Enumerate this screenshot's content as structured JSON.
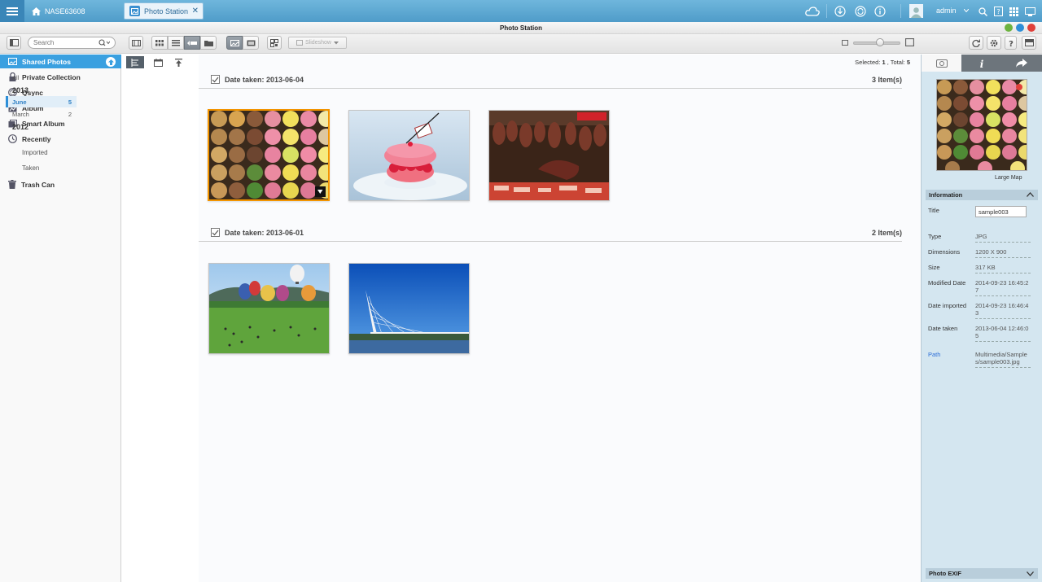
{
  "topbar": {
    "nas_name": "NASE63608",
    "app_tab": "Photo Station",
    "user": "admin"
  },
  "window": {
    "title": "Photo Station"
  },
  "toolbar": {
    "search_placeholder": "Search",
    "slideshow": "Slideshow"
  },
  "sidebar": {
    "items": [
      {
        "label": "Shared Photos",
        "icon": "shared-photos-icon"
      },
      {
        "label": "Private Collection",
        "icon": "lock-icon"
      },
      {
        "label": "Qsync",
        "icon": "qsync-icon"
      },
      {
        "label": "Album",
        "icon": "album-icon"
      },
      {
        "label": "Smart Album",
        "icon": "smart-album-icon"
      },
      {
        "label": "Recently",
        "icon": "clock-icon"
      },
      {
        "label": "Trash Can",
        "icon": "trash-icon"
      }
    ],
    "recent_sub": [
      "Imported",
      "Taken"
    ]
  },
  "timeline": {
    "all": "All",
    "year_2013": "2013",
    "june": "June",
    "june_count": "5",
    "march": "March",
    "march_count": "2",
    "year_2012": "2012"
  },
  "main": {
    "selected_label": "Selected: ",
    "selected_count": "1",
    "total_label": " , Total: ",
    "total_count": "5",
    "groups": [
      {
        "title": "Date taken: 2013-06-04",
        "count": "3 Item(s)"
      },
      {
        "title": "Date taken: 2013-06-01",
        "count": "2 Item(s)"
      }
    ]
  },
  "info_panel": {
    "large_map": "Large Map",
    "information": "Information",
    "title_label": "Title",
    "title_value": "sample003",
    "type_label": "Type",
    "type_value": "JPG",
    "dimensions_label": "Dimensions",
    "dimensions_value": "1200 X 900",
    "size_label": "Size",
    "size_value": "317 KB",
    "modified_label": "Modified Date",
    "modified_value": "2014-09-23 16:45:27",
    "imported_label": "Date imported",
    "imported_value": "2014-09-23 16:46:43",
    "taken_label": "Date taken",
    "taken_value": "2013-06-04 12:46:05",
    "path_label": "Path",
    "path_value": "Multimedia/Samples/sample003.jpg",
    "exif": "Photo EXIF"
  },
  "colors": {
    "topbar": "#4f9cc9",
    "selection": "#3aa0e0",
    "thumb_selected_border": "#f29400",
    "path_link": "#2e6fd8"
  }
}
